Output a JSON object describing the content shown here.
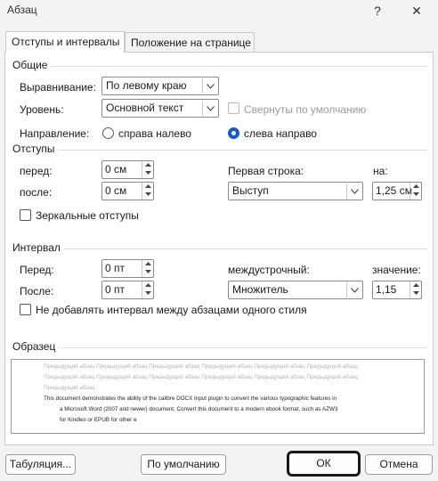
{
  "window": {
    "title": "Абзац",
    "help_glyph": "?",
    "close_glyph": "✕"
  },
  "tabs": [
    {
      "label": "Отступы и интервалы",
      "active": true
    },
    {
      "label": "Положение на странице",
      "active": false
    }
  ],
  "general": {
    "heading": "Общие",
    "alignment_label": "Выравнивание:",
    "alignment_value": "По левому краю",
    "level_label": "Уровень:",
    "level_value": "Основной текст",
    "collapsed_label": "Свернуты по умолчанию",
    "direction_label": "Направление:",
    "rtl_label": "справа налево",
    "ltr_label": "слева направо"
  },
  "indents": {
    "heading": "Отступы",
    "before_label": "перед:",
    "before_value": "0 см",
    "after_label": "после:",
    "after_value": "0 см",
    "first_line_label": "Первая строка:",
    "first_line_value": "Выступ",
    "by_label": "на:",
    "by_value": "1,25 см",
    "mirror_label": "Зеркальные отступы"
  },
  "spacing": {
    "heading": "Интервал",
    "before_label": "Перед:",
    "before_value": "0 пт",
    "after_label": "После:",
    "after_value": "0 пт",
    "line_label": "междустрочный:",
    "line_value": "Множитель",
    "at_label": "значение:",
    "at_value": "1,15",
    "no_space_label": "Не добавлять интервал между абзацами одного стиля"
  },
  "preview": {
    "heading": "Образец",
    "prev_line1": "Предыдущий абзац Предыдущий абзац Предыдущий абзац Предыдущий абзац Предыдущий абзац Предыдущий абзац",
    "prev_line2": "Предыдущий абзац Предыдущий абзац Предыдущий абзац Предыдущий абзац Предыдущий абзац Предыдущий абзац",
    "prev_line3": "Предыдущий абзац",
    "text_line1": "This document demonstrates the ability of the calibre DOCX Input plugin to convert the various typographic features in",
    "text_line2": "a Microsoft Word (2007 and newer) document. Convert this document to a modern ebook format, such as AZW3",
    "text_line3": "for Kindles or EPUB for other e"
  },
  "buttons": {
    "tabs": "Табуляция...",
    "default": "По умолчанию",
    "ok": "ОК",
    "cancel": "Отмена"
  },
  "colors": {
    "accent": "#0a5fcc"
  }
}
